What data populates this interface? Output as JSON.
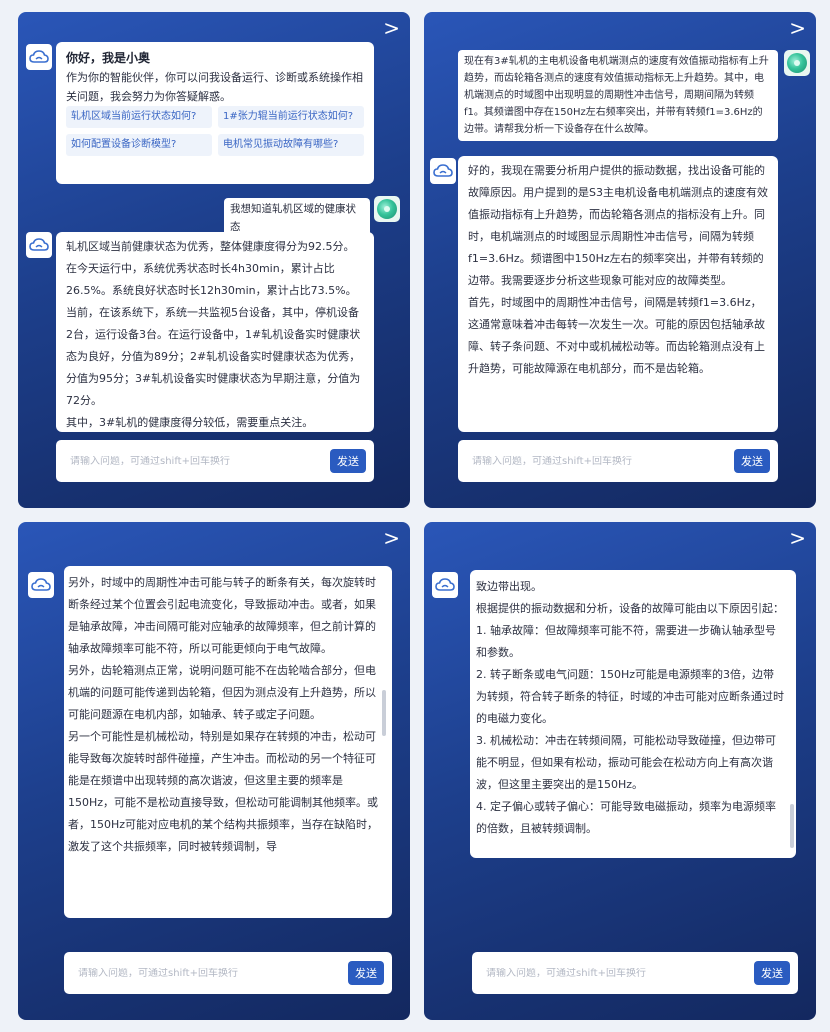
{
  "nav": {
    "next_glyph": ">"
  },
  "icons": {
    "bot": "cloud-icon",
    "user": "user-avatar-icon",
    "next": "chevron-right-icon"
  },
  "colors": {
    "panel": "#2a56b8",
    "send": "#2a5bc0",
    "chip_text": "#3a66c4"
  },
  "input": {
    "placeholder": "请输入问题，可通过shift+回车换行",
    "send_label": "发送"
  },
  "panel1": {
    "greeting": {
      "title": "你好，我是小奥",
      "body": "作为你的智能伙伴，你可以问我设备运行、诊断或系统操作相关问题，我会努力为你答疑解惑。",
      "suggestions": [
        "轧机区域当前运行状态如何?",
        "1#张力辊当前运行状态如何?",
        "如何配置设备诊断模型?",
        "电机常见振动故障有哪些?"
      ]
    },
    "user_msg": "我想知道轧机区域的健康状态",
    "reply": [
      "轧机区域当前健康状态为优秀，整体健康度得分为92.5分。在今天运行中，系统优秀状态时长4h30min，累计占比26.5%。系统良好状态时长12h30min，累计占比73.5%。",
      "当前，在该系统下，系统一共监视5台设备，其中，停机设备2台，运行设备3台。在运行设备中，1#轧机设备实时健康状态为良好，分值为89分；2#轧机设备实时健康状态为优秀，分值为95分；3#轧机设备实时健康状态为早期注意，分值为72分。",
      "其中，3#轧机的健康度得分较低，需要重点关注。"
    ]
  },
  "panel2": {
    "user_msg": "现在有3#轧机的主电机设备电机端测点的速度有效值振动指标有上升趋势，而齿轮箱各测点的速度有效值振动指标无上升趋势。其中，电机端测点的时域图中出现明显的周期性冲击信号，周期间隔为转频f1。其频谱图中存在150Hz左右频率突出，并带有转频f1=3.6Hz的边带。请帮我分析一下设备存在什么故障。",
    "reply": [
      "好的，我现在需要分析用户提供的振动数据，找出设备可能的故障原因。用户提到的是S3主电机设备电机端测点的速度有效值振动指标有上升趋势，而齿轮箱各测点的指标没有上升。同时，电机端测点的时域图显示周期性冲击信号，间隔为转频f1=3.6Hz。频谱图中150Hz左右的频率突出，并带有转频的边带。我需要逐步分析这些现象可能对应的故障类型。",
      "首先，时域图中的周期性冲击信号，间隔是转频f1=3.6Hz，这通常意味着冲击每转一次发生一次。可能的原因包括轴承故障、转子条问题、不对中或机械松动等。而齿轮箱测点没有上升趋势，可能故障源在电机部分，而不是齿轮箱。"
    ]
  },
  "panel3": {
    "reply": [
      "另外，时域中的周期性冲击可能与转子的断条有关，每次旋转时断条经过某个位置会引起电流变化，导致振动冲击。或者，如果是轴承故障，冲击间隔可能对应轴承的故障频率，但之前计算的轴承故障频率可能不符，所以可能更倾向于电气故障。",
      "另外，齿轮箱测点正常，说明问题可能不在齿轮啮合部分，但电机端的问题可能传递到齿轮箱，但因为测点没有上升趋势，所以可能问题源在电机内部，如轴承、转子或定子问题。",
      "另一个可能性是机械松动，特别是如果存在转频的冲击，松动可能导致每次旋转时部件碰撞，产生冲击。而松动的另一个特征可能是在频谱中出现转频的高次谐波，但这里主要的频率是150Hz，可能不是松动直接导致，但松动可能调制其他频率。或者，150Hz可能对应电机的某个结构共振频率，当存在缺陷时，激发了这个共振频率，同时被转频调制，导"
    ]
  },
  "panel4": {
    "reply": [
      "致边带出现。",
      "根据提供的振动数据和分析，设备的故障可能由以下原因引起：",
      "1. 轴承故障：但故障频率可能不符，需要进一步确认轴承型号和参数。",
      "2. 转子断条或电气问题：150Hz可能是电源频率的3倍，边带为转频，符合转子断条的特征，时域的冲击可能对应断条通过时的电磁力变化。",
      "3. 机械松动：冲击在转频间隔，可能松动导致碰撞，但边带可能不明显，但如果有松动，振动可能会在松动方向上有高次谐波，但这里主要突出的是150Hz。",
      "4. 定子偏心或转子偏心：可能导致电磁振动，频率为电源频率的倍数，且被转频调制。"
    ]
  }
}
